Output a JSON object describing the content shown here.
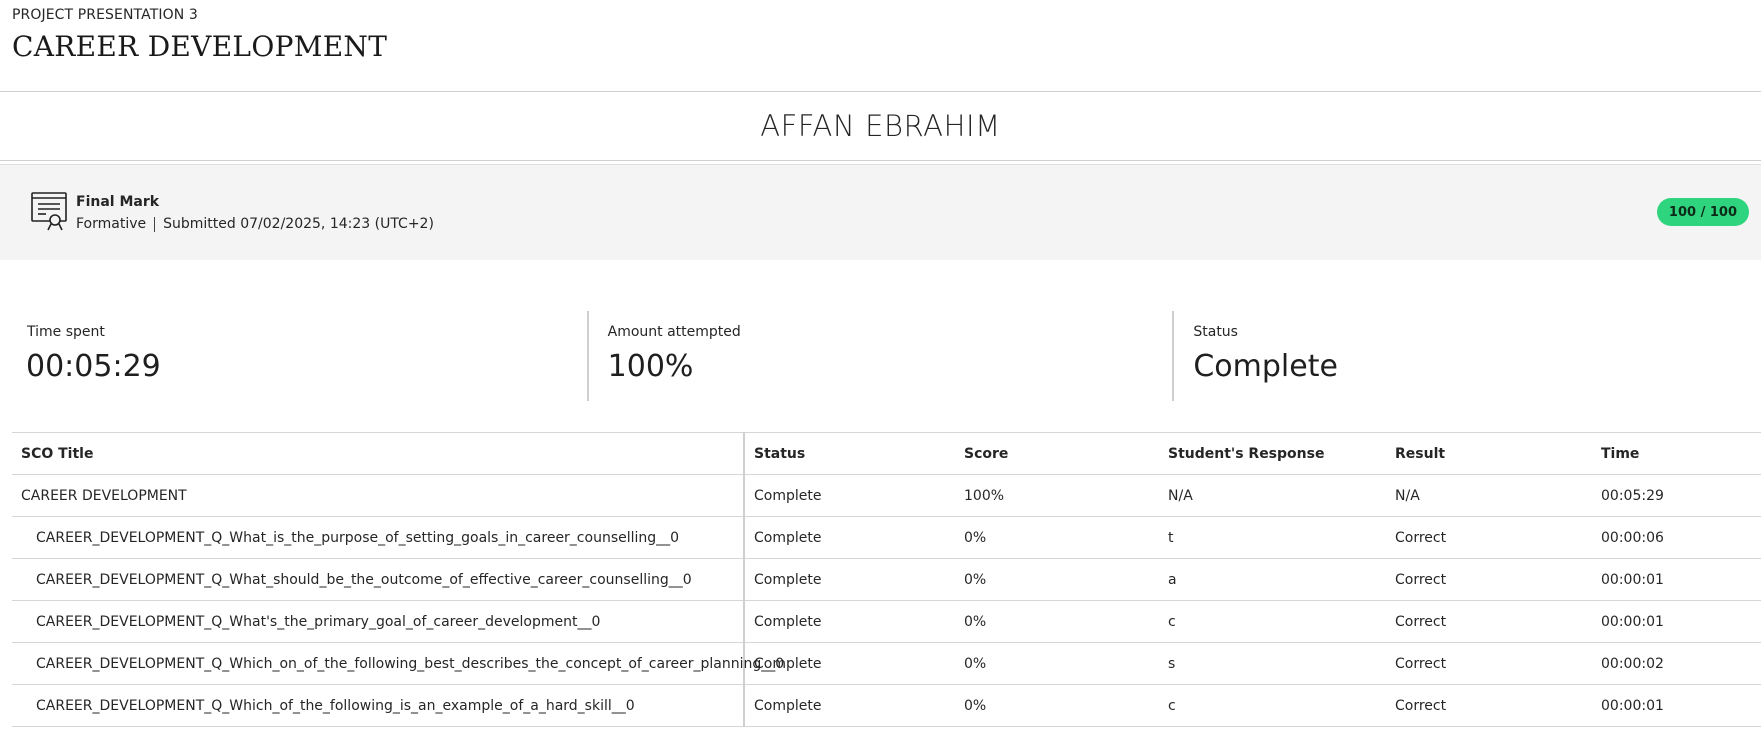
{
  "header": {
    "eyebrow": "PROJECT PRESENTATION 3",
    "title": "CAREER DEVELOPMENT"
  },
  "student": {
    "name": "AFFAN EBRAHIM"
  },
  "mark": {
    "icon": "certificate-icon",
    "label": "Final Mark",
    "type": "Formative",
    "submitted": "Submitted 07/02/2025, 14:23 (UTC+2)",
    "score": "100 / 100",
    "score_color": "#2fd47e"
  },
  "stats": [
    {
      "label": "Time spent",
      "value": "00:05:29"
    },
    {
      "label": "Amount attempted",
      "value": "100%"
    },
    {
      "label": "Status",
      "value": "Complete"
    }
  ],
  "table": {
    "headers": [
      "SCO Title",
      "Status",
      "Score",
      "Student's Response",
      "Result",
      "Time"
    ],
    "rows": [
      [
        "CAREER DEVELOPMENT",
        "Complete",
        "100%",
        "N/A",
        "N/A",
        "00:05:29"
      ],
      [
        "CAREER_DEVELOPMENT_Q_What_is_the_purpose_of_setting_goals_in_career_counselling__0",
        "Complete",
        "0%",
        "t",
        "Correct",
        "00:00:06"
      ],
      [
        "CAREER_DEVELOPMENT_Q_What_should_be_the_outcome_of_effective_career_counselling__0",
        "Complete",
        "0%",
        "a",
        "Correct",
        "00:00:01"
      ],
      [
        "CAREER_DEVELOPMENT_Q_What's_the_primary_goal_of_career_development__0",
        "Complete",
        "0%",
        "c",
        "Correct",
        "00:00:01"
      ],
      [
        "CAREER_DEVELOPMENT_Q_Which_on_of_the_following_best_describes_the_concept_of_career_planning__0",
        "Complete",
        "0%",
        "s",
        "Correct",
        "00:00:02"
      ],
      [
        "CAREER_DEVELOPMENT_Q_Which_of_the_following_is_an_example_of_a_hard_skill__0",
        "Complete",
        "0%",
        "c",
        "Correct",
        "00:00:01"
      ]
    ]
  }
}
